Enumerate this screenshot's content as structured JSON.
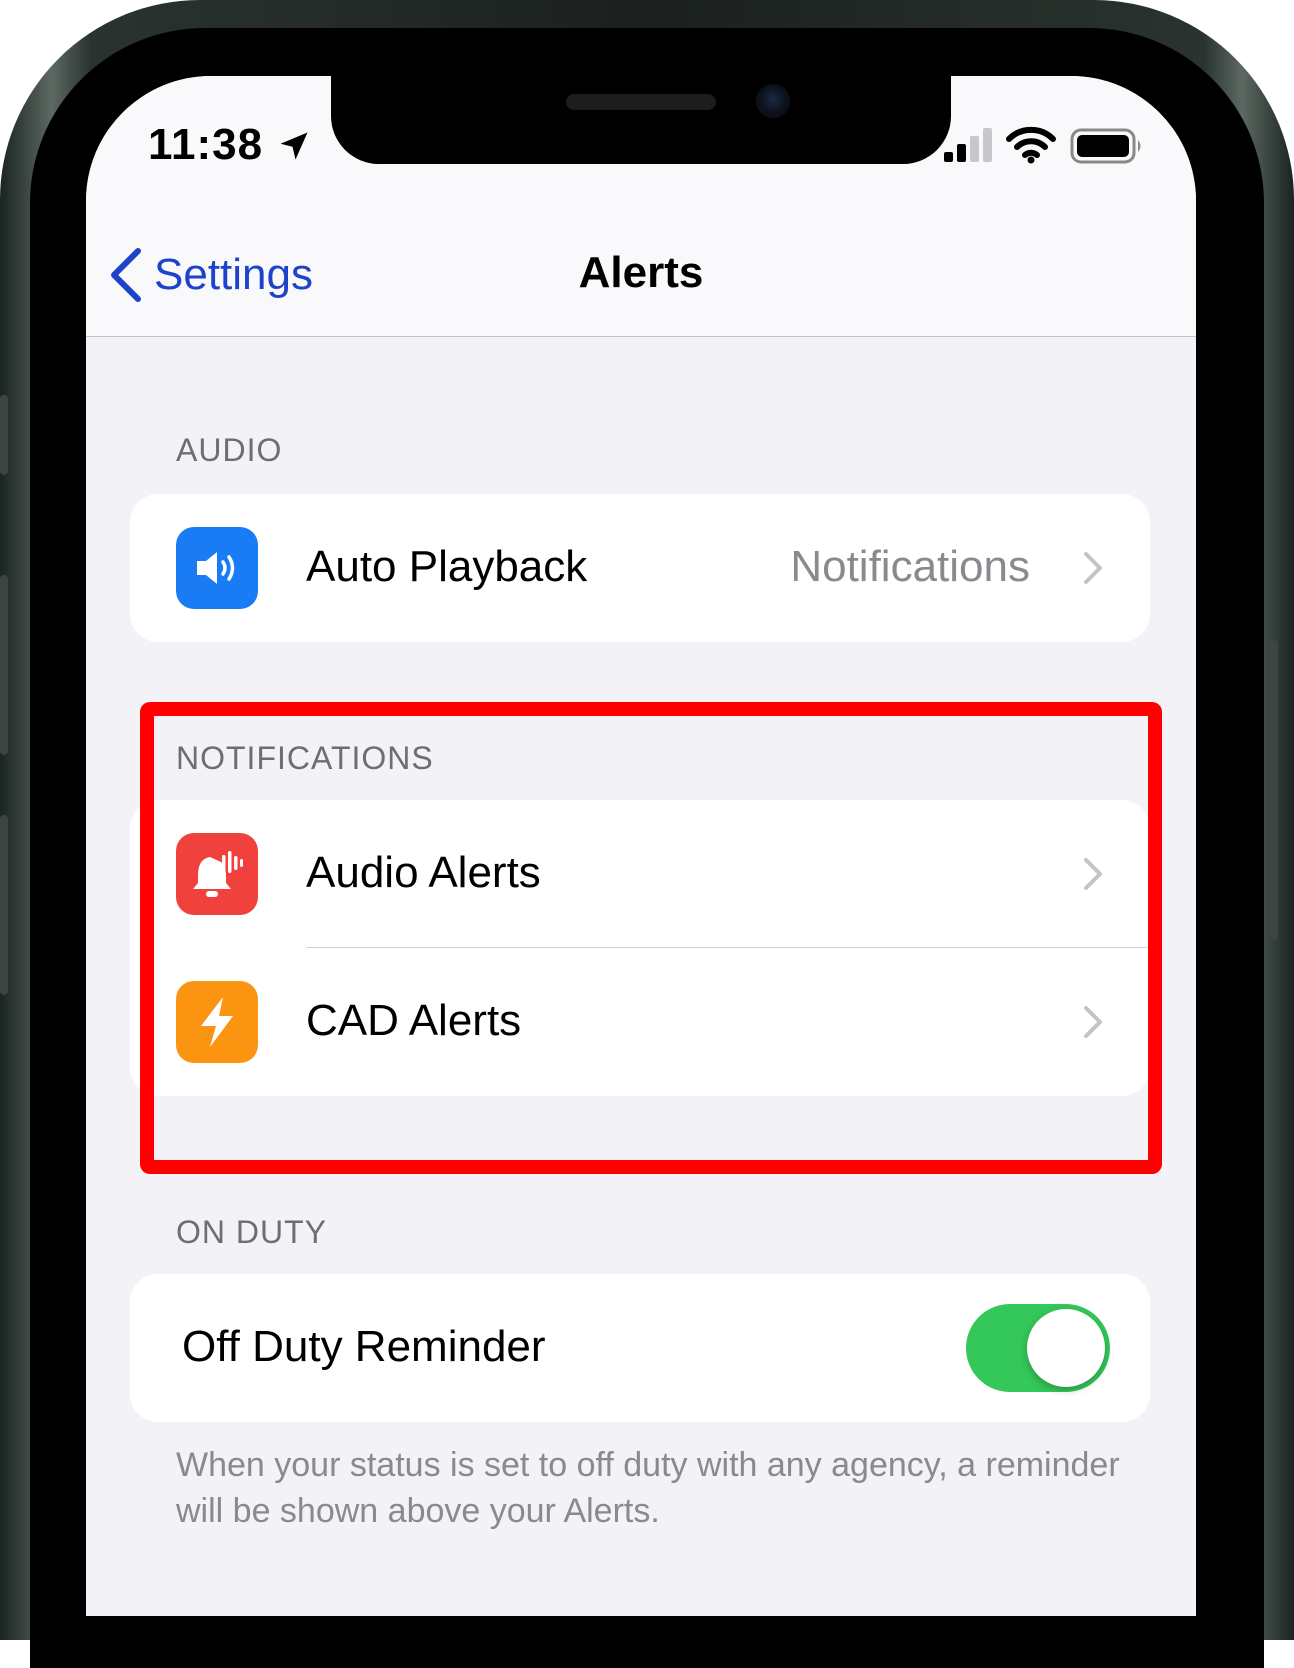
{
  "status": {
    "time": "11:38",
    "location_icon": "location-arrow-icon",
    "signal_icon": "cellular-signal-icon",
    "wifi_icon": "wifi-icon",
    "battery_icon": "battery-icon"
  },
  "nav": {
    "back_label": "Settings",
    "title": "Alerts"
  },
  "sections": {
    "audio": {
      "header": "AUDIO",
      "rows": [
        {
          "label": "Auto Playback",
          "value": "Notifications",
          "icon": "speaker-icon",
          "icon_color": "#1a7cf5"
        }
      ]
    },
    "notifications": {
      "header": "NOTIFICATIONS",
      "rows": [
        {
          "label": "Audio Alerts",
          "icon": "bell-sound-icon",
          "icon_color": "#f0413c"
        },
        {
          "label": "CAD Alerts",
          "icon": "lightning-bolt-icon",
          "icon_color": "#fb9511"
        }
      ]
    },
    "on_duty": {
      "header": "ON DUTY",
      "rows": [
        {
          "label": "Off Duty Reminder",
          "toggle_on": true
        }
      ],
      "footer": "When your status is set to off duty with any agency, a reminder will be shown above your Alerts."
    }
  },
  "colors": {
    "accent": "#1d44c8",
    "toggle_on": "#34c759",
    "highlight": "#ff0000"
  }
}
